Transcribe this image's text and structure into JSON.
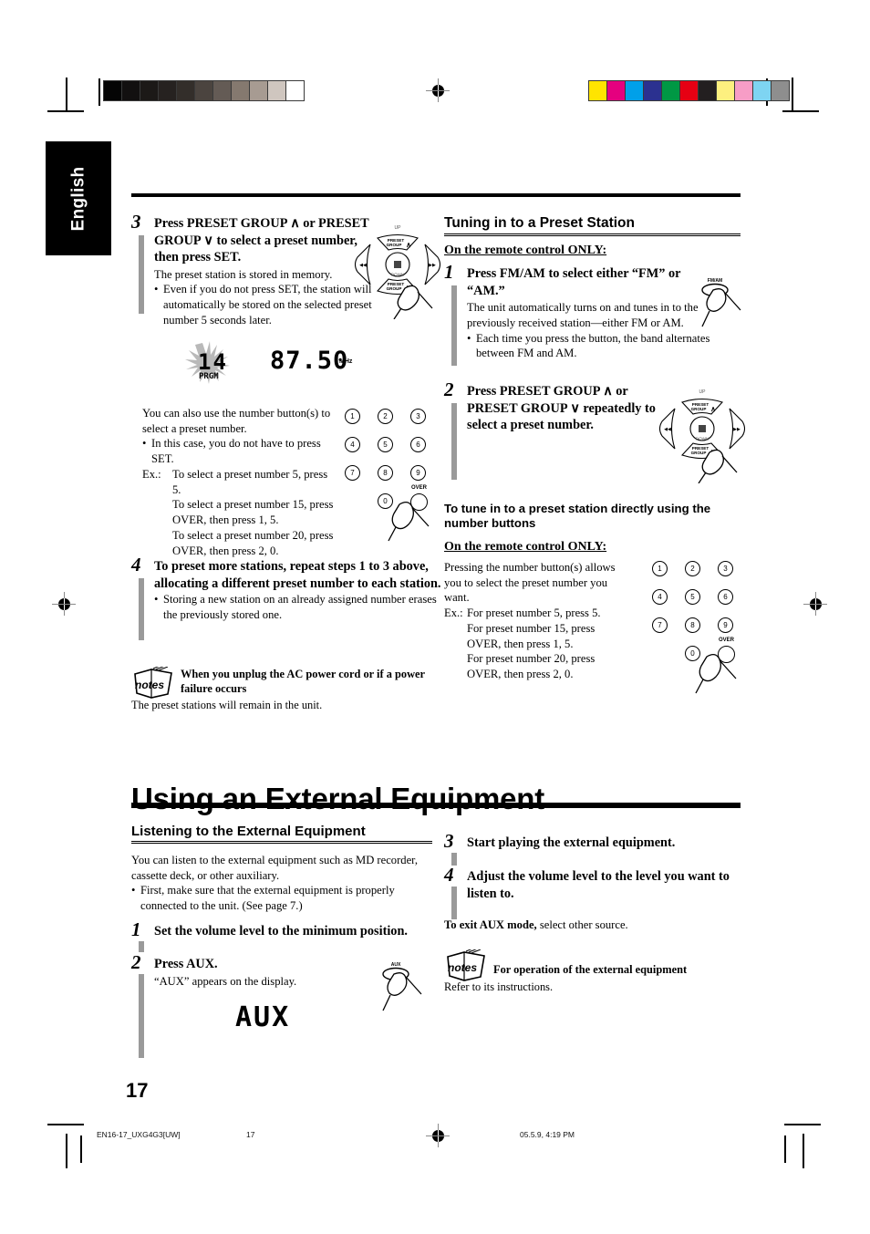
{
  "page": {
    "language_tab": "English",
    "page_number": "17",
    "footer_file": "EN16-17_UXG4G3[UW]",
    "footer_page": "17",
    "footer_date": "05.5.9, 4:19 PM"
  },
  "print_marks": {
    "gray_swatches": [
      "#050505",
      "#121010",
      "#1c1917",
      "#262220",
      "#332e2a",
      "#4b443f",
      "#645b55",
      "#85796f",
      "#a79b92",
      "#cfc6bf",
      "#ffffff"
    ],
    "color_swatches": [
      "#ffe400",
      "#e5007f",
      "#00a0e9",
      "#2b3190",
      "#009844",
      "#e60013",
      "#231f20",
      "#fdf07f",
      "#f79dc6",
      "#7ed4f2",
      "#8e8e8e"
    ]
  },
  "left_column": {
    "step3": {
      "number": "3",
      "heading": "Press PRESET GROUP ∧ or PRESET GROUP ∨ to select a preset number, then press SET.",
      "body": "The preset station is stored in memory.",
      "bullets": [
        "Even if you do not press SET, the station will automatically be stored on the selected preset number 5 seconds later."
      ],
      "display": {
        "preset": "14",
        "prgm_label": "PRGM",
        "frequency": "87.50",
        "unit": "MHz"
      },
      "note_text_1": "You can also use the number button(s) to select a preset number.",
      "note_bullet": "In this case, you do not have to press SET.",
      "example_label": "Ex.:",
      "example_lines": [
        "To select a preset number 5, press 5.",
        "To select a preset number 15, press OVER, then press 1, 5.",
        "To select a preset number 20, press OVER, then press 2, 0."
      ]
    },
    "step4": {
      "number": "4",
      "heading": "To preset more stations, repeat steps 1 to 3 above, allocating a different preset number to each station.",
      "bullets": [
        "Storing a new station on an already assigned number erases the previously stored one."
      ]
    },
    "notes": {
      "icon_label": "notes",
      "title": "When you unplug the AC power cord or if a power failure occurs",
      "body": "The preset stations will remain in the unit."
    },
    "keypad": {
      "keys": [
        "1",
        "2",
        "3",
        "4",
        "5",
        "6",
        "7",
        "8",
        "9",
        "0"
      ],
      "over_label": "OVER"
    }
  },
  "right_column": {
    "section_title": "Tuning in to a Preset Station",
    "on_remote_1": "On the remote control ONLY:",
    "step1": {
      "number": "1",
      "heading": "Press FM/AM to select either “FM” or “AM.”",
      "body": "The unit automatically turns on and tunes in to the previously received station—either FM or AM.",
      "bullets": [
        "Each time you press the button, the band alternates between FM and AM."
      ],
      "button_label": "FM/AM"
    },
    "step2": {
      "number": "2",
      "heading": "Press PRESET GROUP ∧ or PRESET GROUP ∨ repeatedly to select a preset number."
    },
    "subheading": "To tune in to a preset station directly using the number buttons",
    "on_remote_2": "On the remote control ONLY:",
    "direct_body": "Pressing the number button(s) allows you to select the preset number you want.",
    "example_label": "Ex.:",
    "example_lines": [
      "For preset number 5, press 5.",
      "For preset number 15, press OVER, then press 1, 5.",
      "For preset number 20, press OVER, then press 2, 0."
    ],
    "keypad": {
      "keys": [
        "1",
        "2",
        "3",
        "4",
        "5",
        "6",
        "7",
        "8",
        "9",
        "0"
      ],
      "over_label": "OVER"
    }
  },
  "external": {
    "title": "Using an External Equipment",
    "sub_title": "Listening to the External Equipment",
    "intro": "You can listen to the external equipment such as MD recorder, cassette deck, or other auxiliary.",
    "intro_bullet": "First, make sure that the external equipment is properly connected to the unit. (See page 7.)",
    "step1": {
      "number": "1",
      "heading": "Set the volume level to the minimum position."
    },
    "step2": {
      "number": "2",
      "heading": "Press AUX.",
      "body": "“AUX” appears on the display.",
      "button_label": "AUX",
      "display": "AUX"
    },
    "step3": {
      "number": "3",
      "heading": "Start playing the external equipment."
    },
    "step4": {
      "number": "4",
      "heading": "Adjust the volume level to the level you want to listen to."
    },
    "exit_bold": "To exit AUX mode,",
    "exit_rest": " select other source.",
    "notes": {
      "icon_label": "notes",
      "title": "For operation of the external equipment",
      "body": "Refer to its instructions."
    }
  },
  "remote": {
    "up_label": "UP",
    "down_label": "DOWN",
    "preset_group_up": "PRESET GROUP ∧",
    "preset_group_down": "PRESET GROUP ∨"
  }
}
